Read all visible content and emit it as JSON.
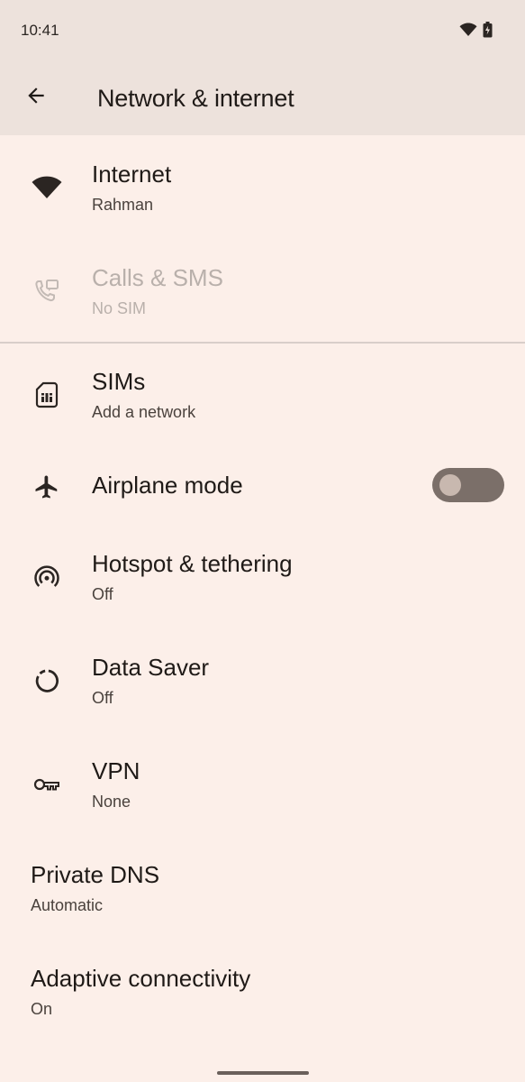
{
  "status_bar": {
    "time": "10:41"
  },
  "app_bar": {
    "title": "Network & internet"
  },
  "items": [
    {
      "key": "internet",
      "title": "Internet",
      "subtitle": "Rahman",
      "icon": "wifi-icon",
      "enabled": true
    },
    {
      "key": "calls",
      "title": "Calls & SMS",
      "subtitle": "No SIM",
      "icon": "calls-sms-icon",
      "enabled": false
    },
    {
      "key": "sims",
      "title": "SIMs",
      "subtitle": "Add a network",
      "icon": "sim-card-icon",
      "enabled": true
    },
    {
      "key": "airplane",
      "title": "Airplane mode",
      "subtitle": "",
      "icon": "airplane-icon",
      "enabled": true,
      "toggle_on": false
    },
    {
      "key": "hotspot",
      "title": "Hotspot & tethering",
      "subtitle": "Off",
      "icon": "hotspot-icon",
      "enabled": true
    },
    {
      "key": "datasaver",
      "title": "Data Saver",
      "subtitle": "Off",
      "icon": "data-saver-icon",
      "enabled": true
    },
    {
      "key": "vpn",
      "title": "VPN",
      "subtitle": "None",
      "icon": "vpn-key-icon",
      "enabled": true
    },
    {
      "key": "privatedns",
      "title": "Private DNS",
      "subtitle": "Automatic",
      "icon": "",
      "enabled": true
    },
    {
      "key": "adaptive",
      "title": "Adaptive connectivity",
      "subtitle": "On",
      "icon": "",
      "enabled": true
    }
  ],
  "colors": {
    "background": "#fcefe9",
    "app_bar": "#ede2dc",
    "toggle_track": "#7b6f69",
    "toggle_thumb": "#c8b8af"
  }
}
